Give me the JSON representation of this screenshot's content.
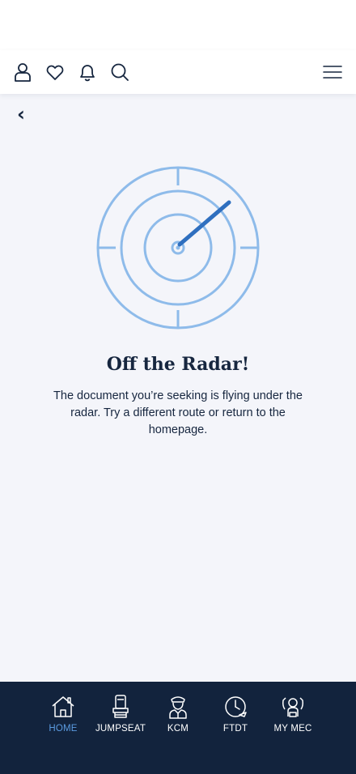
{
  "header": {
    "icons": [
      "user-icon",
      "heart-icon",
      "bell-icon",
      "search-icon",
      "menu-icon"
    ]
  },
  "back": {
    "label": "‹"
  },
  "error": {
    "title": "Off the Radar!",
    "message": "The document you’re seeking is flying under the radar. Try a different route or return to the homepage."
  },
  "nav": {
    "items": [
      {
        "label": "HOME",
        "icon": "home-icon",
        "active": true
      },
      {
        "label": "JUMPSEAT",
        "icon": "seat-icon",
        "active": false
      },
      {
        "label": "KCM",
        "icon": "pilot-icon",
        "active": false
      },
      {
        "label": "FTDT",
        "icon": "clock-plane-icon",
        "active": false
      },
      {
        "label": "MY MEC",
        "icon": "people-icon",
        "active": false
      }
    ]
  },
  "colors": {
    "navy": "#12233d",
    "text": "#16263f",
    "accent": "#5b9be0",
    "radar_light": "#8ebbea",
    "radar_dark": "#2f6fbf",
    "background": "#f4f5fa"
  }
}
